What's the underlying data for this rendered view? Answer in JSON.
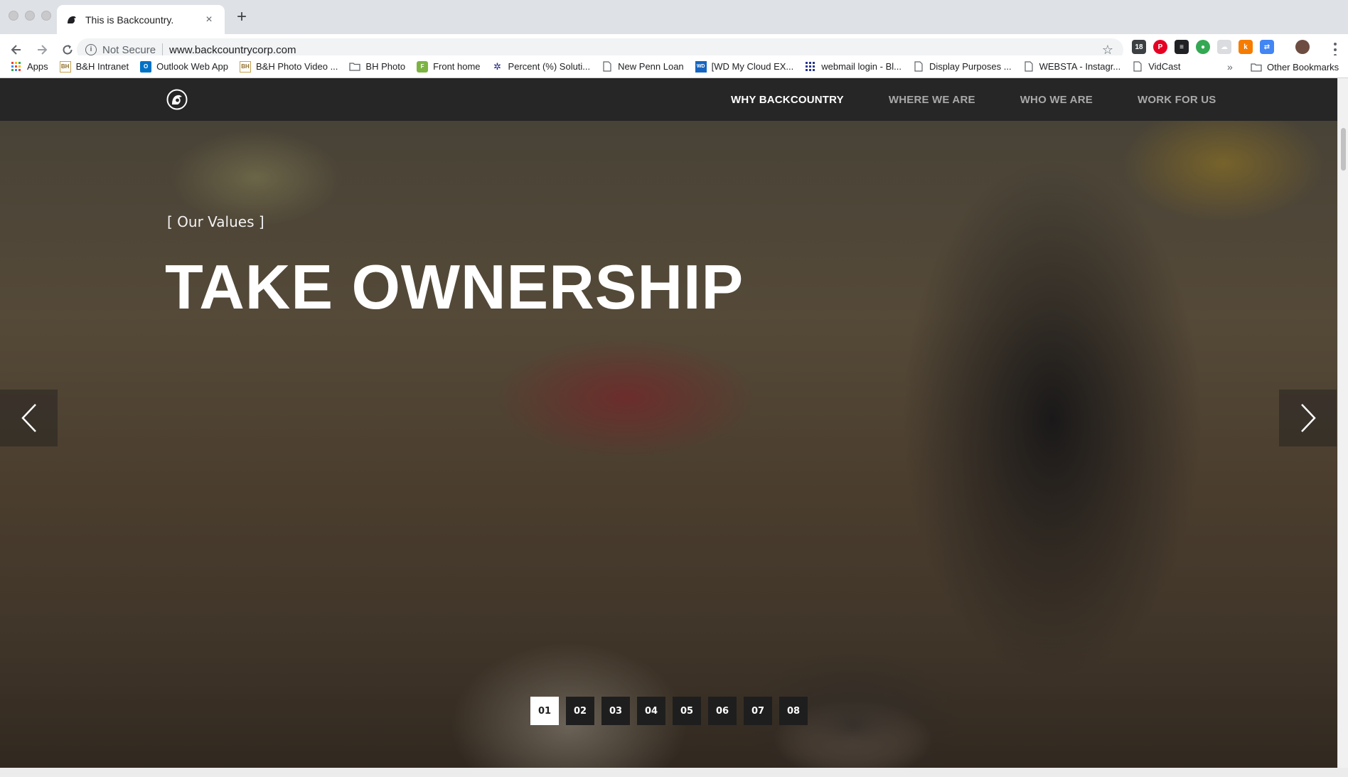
{
  "browser": {
    "tab_title": "This is Backcountry.",
    "tab_close": "×",
    "new_tab": "+",
    "security_label": "Not Secure",
    "url": "www.backcountrycorp.com",
    "info_glyph": "i",
    "star_glyph": "☆"
  },
  "bookmarks": {
    "items": [
      {
        "label": "Apps",
        "icon": "apps-grid-icon",
        "color": "#ea4335"
      },
      {
        "label": "B&H Intranet",
        "icon": "bh-favicon",
        "color": "#c6a14b"
      },
      {
        "label": "Outlook Web App",
        "icon": "outlook-icon",
        "color": "#0072c6"
      },
      {
        "label": "B&H Photo Video ...",
        "icon": "bh-favicon",
        "color": "#c6a14b"
      },
      {
        "label": "BH Photo",
        "icon": "folder-icon",
        "color": "#5f6368"
      },
      {
        "label": "Front home",
        "icon": "front-icon",
        "color": "#7cb342"
      },
      {
        "label": "Percent (%) Soluti...",
        "icon": "percent-icon",
        "color": "#1a237e"
      },
      {
        "label": "New Penn Loan",
        "icon": "page-icon",
        "color": "#5f6368"
      },
      {
        "label": "[WD My Cloud EX...",
        "icon": "wd-icon",
        "color": "#1565c0"
      },
      {
        "label": "webmail login - Bl...",
        "icon": "webmail-grid-icon",
        "color": "#283593"
      },
      {
        "label": "Display Purposes ...",
        "icon": "page-icon",
        "color": "#5f6368"
      },
      {
        "label": "WEBSTA - Instagr...",
        "icon": "page-icon",
        "color": "#5f6368"
      },
      {
        "label": "VidCast",
        "icon": "page-icon",
        "color": "#5f6368"
      }
    ],
    "more": "»",
    "other": "Other Bookmarks"
  },
  "site": {
    "nav": [
      {
        "label": "WHY BACKCOUNTRY",
        "active": true
      },
      {
        "label": "WHERE WE ARE",
        "active": false
      },
      {
        "label": "WHO WE ARE",
        "active": false
      },
      {
        "label": "WORK FOR US",
        "active": false
      }
    ],
    "kicker": "[ Our Values ]",
    "headline": "TAKE OWNERSHIP",
    "slides": [
      "01",
      "02",
      "03",
      "04",
      "05",
      "06",
      "07",
      "08"
    ],
    "active_slide": "01"
  },
  "colors": {
    "nav_bg": "#262626",
    "nav_active": "#ffffff",
    "nav_inactive": "#a9a9a9",
    "pager_bg": "#1e1e1e"
  }
}
